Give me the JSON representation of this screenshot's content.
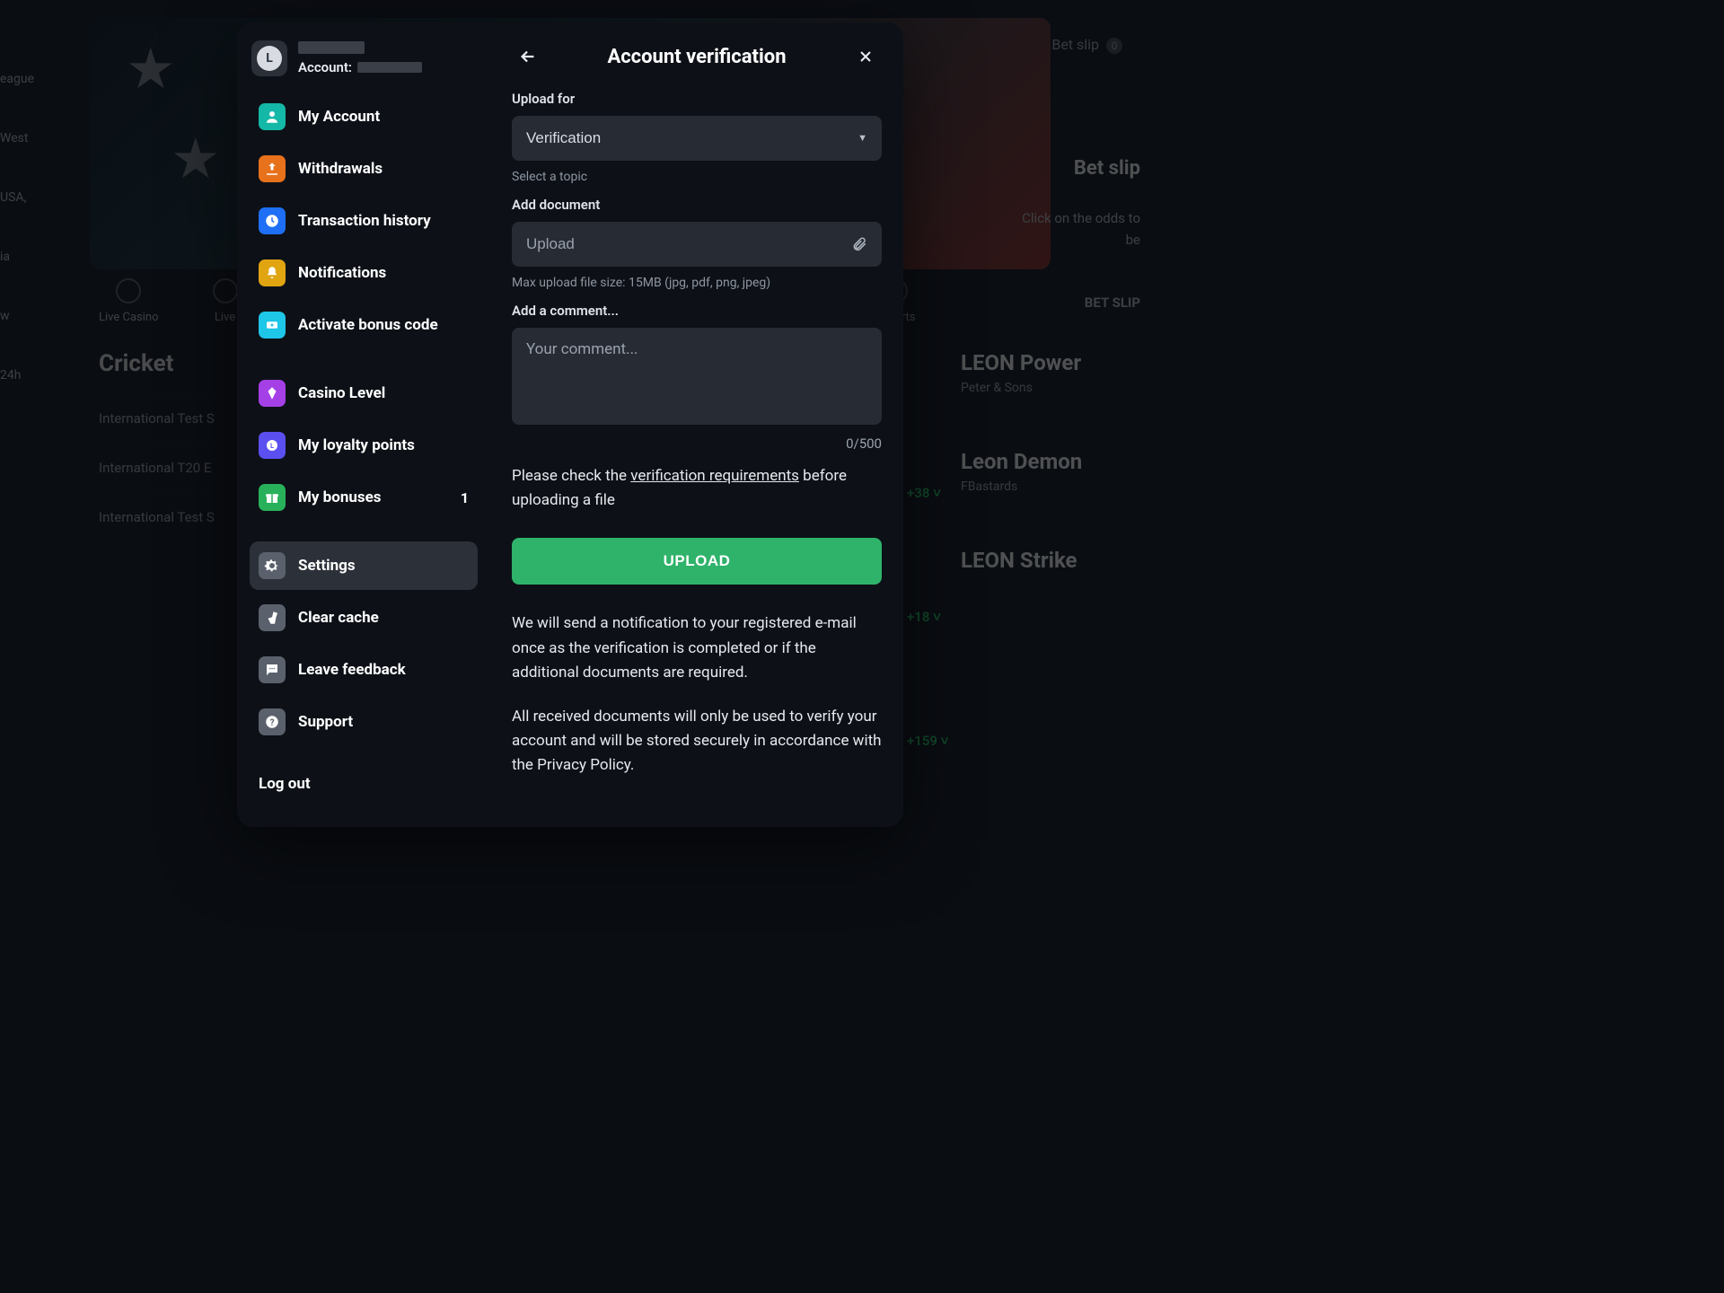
{
  "backdrop": {
    "left_items": [
      "eague",
      "West",
      "USA,",
      "ia",
      "w",
      "24h"
    ],
    "tabs": [
      "Live Casino",
      "Live",
      "eSports"
    ],
    "section_title": "Cricket",
    "rows": [
      "International Test S",
      "International T20 E",
      "International Test S"
    ],
    "right_games": [
      {
        "title": "LEON Power",
        "sub": "Peter & Sons"
      },
      {
        "title": "Leon Demon",
        "sub": "FBastards"
      },
      {
        "title": "LEON Strike",
        "sub": ""
      }
    ],
    "odds": [
      "+38",
      "+18",
      "+159"
    ],
    "betslip_label": "Bet slip",
    "betslip_badge": "0",
    "betslip_title": "Bet slip",
    "betslip_hint1": "Click on the odds to",
    "betslip_hint2": "be",
    "betslip_cta": "BET SLIP"
  },
  "modal": {
    "account_label": "Account:",
    "title": "Account verification",
    "sidebar": [
      {
        "key": "my-account",
        "label": "My Account",
        "icon": "account",
        "cls": "mi-account"
      },
      {
        "key": "withdrawals",
        "label": "Withdrawals",
        "icon": "upload",
        "cls": "mi-withdraw"
      },
      {
        "key": "transaction-history",
        "label": "Transaction history",
        "icon": "clock",
        "cls": "mi-history"
      },
      {
        "key": "notifications",
        "label": "Notifications",
        "icon": "bell",
        "cls": "mi-notif"
      },
      {
        "key": "activate-bonus",
        "label": "Activate bonus code",
        "icon": "ticket",
        "cls": "mi-bonus"
      },
      {
        "gap": true
      },
      {
        "key": "casino-level",
        "label": "Casino Level",
        "icon": "diamond",
        "cls": "mi-casino"
      },
      {
        "key": "loyalty-points",
        "label": "My loyalty points",
        "icon": "badge",
        "cls": "mi-loyalty"
      },
      {
        "key": "my-bonuses",
        "label": "My bonuses",
        "icon": "gift",
        "cls": "mi-bonuses",
        "badge": "1"
      },
      {
        "gap": true
      },
      {
        "key": "settings",
        "label": "Settings",
        "icon": "gear",
        "cls": "mi-settings",
        "active": true
      },
      {
        "key": "clear-cache",
        "label": "Clear cache",
        "icon": "broom",
        "cls": "mi-cache"
      },
      {
        "key": "leave-feedback",
        "label": "Leave feedback",
        "icon": "chat",
        "cls": "mi-feedback"
      },
      {
        "key": "support",
        "label": "Support",
        "icon": "help",
        "cls": "mi-support"
      }
    ],
    "logout": "Log out",
    "form": {
      "upload_for_label": "Upload for",
      "verification_value": "Verification",
      "select_topic_helper": "Select a topic",
      "add_document_label": "Add document",
      "upload_placeholder": "Upload",
      "max_size_helper": "Max upload file size: 15MB (jpg, pdf, png, jpeg)",
      "add_comment_label": "Add a comment...",
      "comment_placeholder": "Your comment...",
      "counter": "0/500",
      "requirements_pre": "Please check the ",
      "requirements_link": "verification requirements",
      "requirements_post": " before uploading a file",
      "upload_button": "UPLOAD",
      "info1": "We will send a notification to your registered e-mail once as the verification is completed or if the additional documents are required.",
      "info2": "All received documents will only be used to verify your account and will be stored securely in accordance with the Privacy Policy."
    }
  }
}
